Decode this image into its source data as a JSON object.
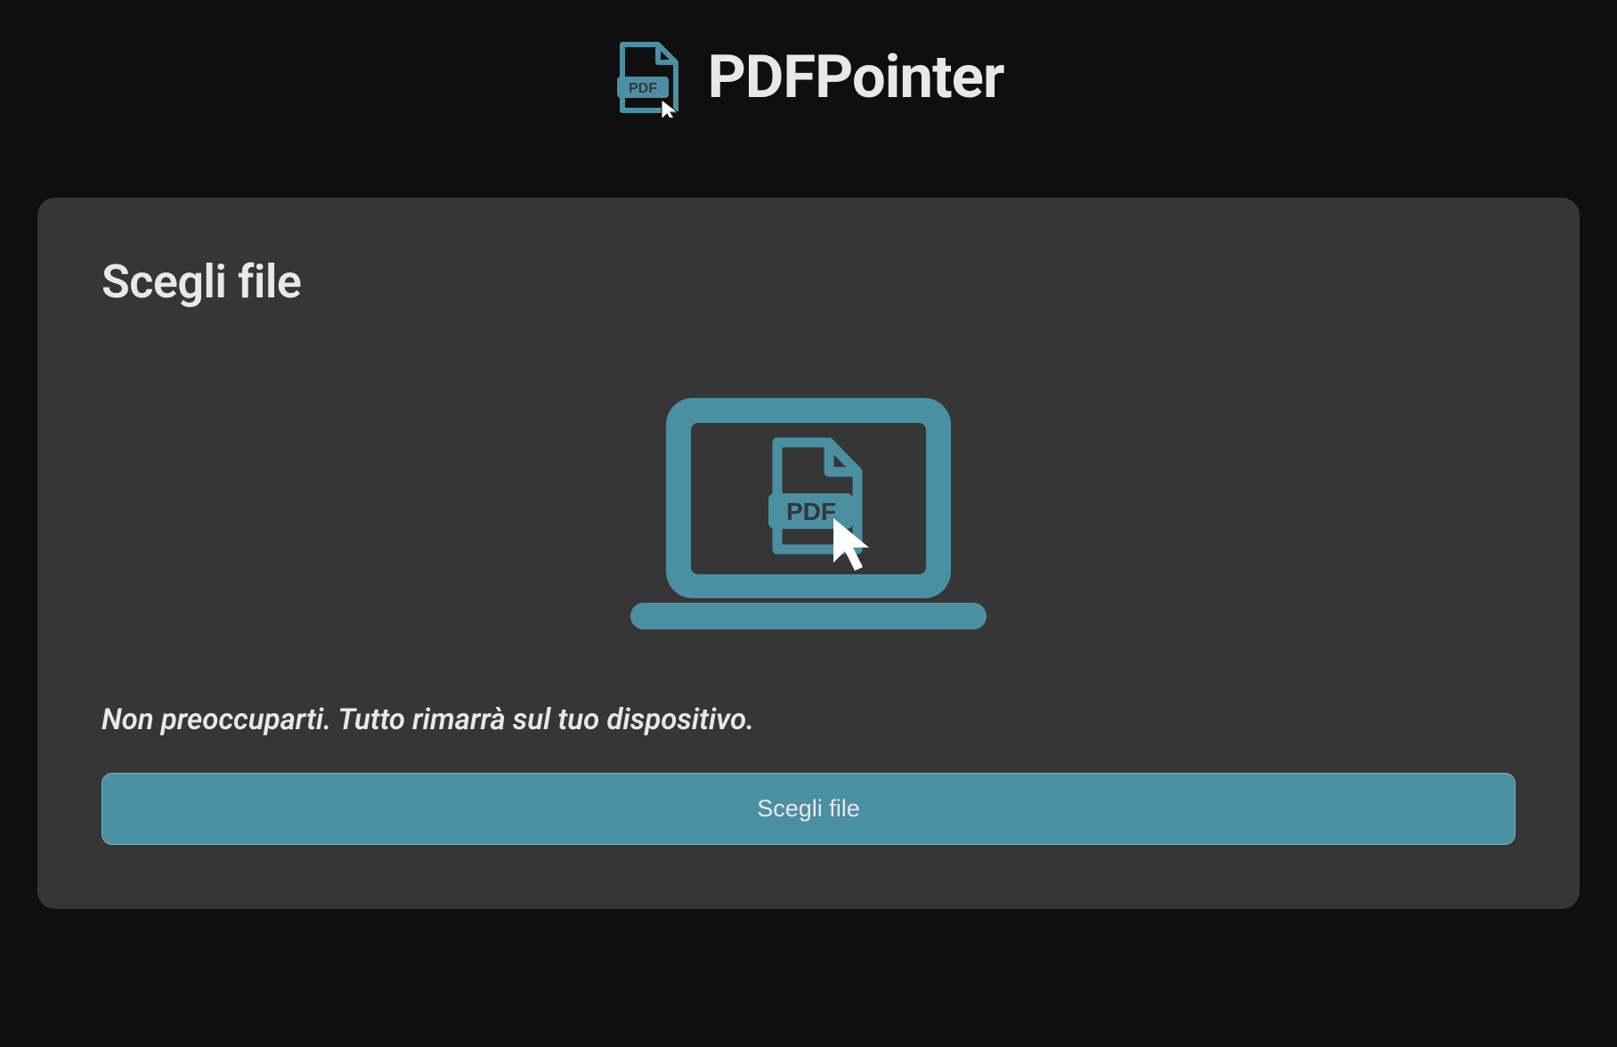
{
  "header": {
    "app_name": "PDFPointer"
  },
  "card": {
    "title": "Scegli file",
    "subtitle": "Non preoccuparti. Tutto rimarrà sul tuo dispositivo.",
    "button_label": "Scegli file"
  },
  "colors": {
    "accent": "#4b8fa3",
    "background": "#0f0f0f",
    "card_bg": "#363636",
    "text": "#e8e8e8"
  }
}
